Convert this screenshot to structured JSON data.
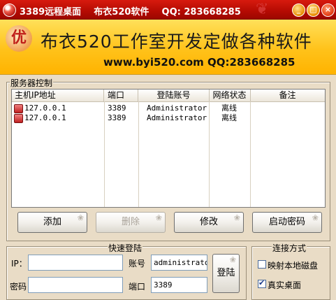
{
  "window": {
    "title": "3389远程桌面    布衣520软件    QQ: 283668285",
    "minimize": "_",
    "maximize": "□",
    "close": "×"
  },
  "banner": {
    "logo_char": "优",
    "slogan": "布衣520工作室开发定做各种软件",
    "contact": "www.byi520.com QQ:283668285"
  },
  "server_panel": {
    "title": "服务器控制",
    "columns": [
      "主机IP地址",
      "端口",
      "登陆账号",
      "网络状态",
      "备注"
    ],
    "rows": [
      {
        "ip": "127.0.0.1",
        "port": "3389",
        "account": "Administrator",
        "status": "离线",
        "note": ""
      },
      {
        "ip": "127.0.0.1",
        "port": "3389",
        "account": "Administrator",
        "status": "离线",
        "note": ""
      }
    ],
    "buttons": {
      "add": "添加",
      "delete": "删除",
      "edit": "修改",
      "launch_password": "启动密码"
    }
  },
  "quick_login": {
    "title": "快速登陆",
    "ip_label": "IP：",
    "ip_value": "",
    "account_label": "账号",
    "account_value": "administrator",
    "password_label": "密码",
    "password_value": "",
    "port_label": "端口",
    "port_value": "3389",
    "login_button": "登陆"
  },
  "connection": {
    "title": "连接方式",
    "map_disk_label": "映射本地磁盘",
    "map_disk_checked": false,
    "real_desktop_label": "真实桌面",
    "real_desktop_checked": true
  },
  "colors": {
    "titlebar": "#c8140a",
    "banner": "#ffc21a",
    "panel_bg": "#e9dcc6"
  }
}
